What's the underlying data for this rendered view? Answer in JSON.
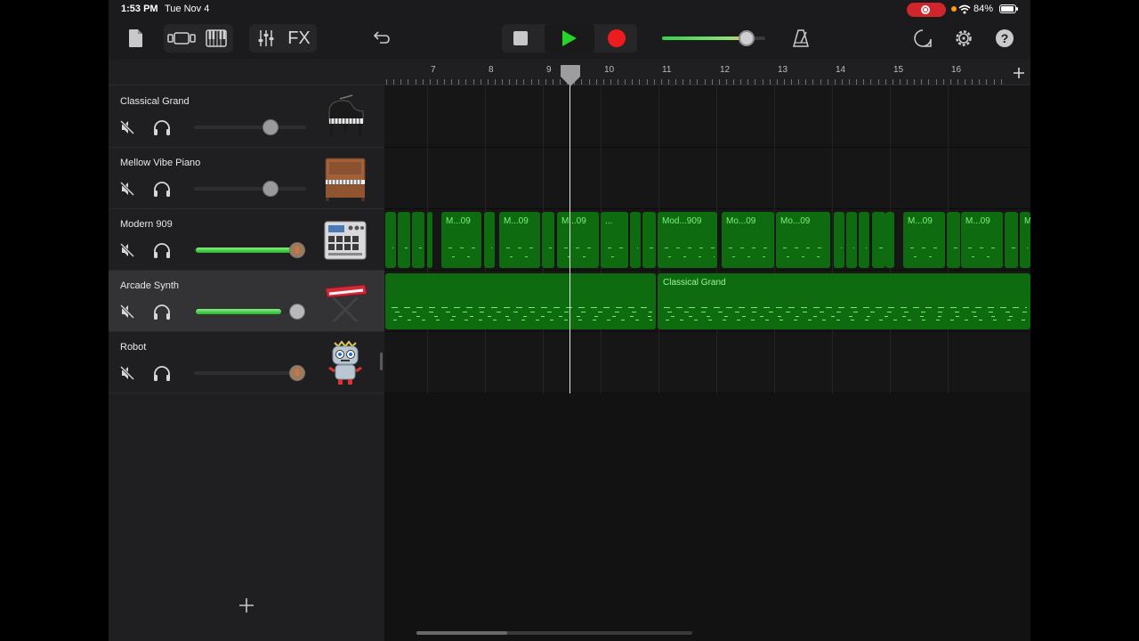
{
  "status_bar": {
    "time": "1:53 PM",
    "date": "Tue Nov 4",
    "battery": "84%"
  },
  "toolbar": {
    "fx_label": "FX",
    "help_label": "?"
  },
  "master_volume": 0.82,
  "tracks": [
    {
      "name": "Classical Grand",
      "icon": "grand-piano-icon",
      "volume": 0.68,
      "meter": 0
    },
    {
      "name": "Mellow Vibe Piano",
      "icon": "upright-piano-icon",
      "volume": 0.68,
      "meter": 0
    },
    {
      "name": "Modern 909",
      "icon": "drum-machine-icon",
      "volume": 0.92,
      "meter": 0.92
    },
    {
      "name": "Arcade Synth",
      "icon": "synth-keyboard-icon",
      "volume": 0.92,
      "meter": 0.76
    },
    {
      "name": "Robot",
      "icon": "robot-icon",
      "volume": 0.92,
      "meter": 0
    }
  ],
  "ruler": {
    "bars": [
      "7",
      "8",
      "9",
      "10",
      "11",
      "12",
      "13",
      "14",
      "15",
      "16"
    ]
  },
  "regions": {
    "modern909": [
      "",
      "",
      "",
      "M...09",
      "M...09",
      "M...09",
      "...",
      "",
      "Mod...909",
      "Mo...09",
      "Mo...09",
      "",
      "",
      "",
      "",
      "M...09",
      "M...09",
      "",
      "M"
    ],
    "arcade_synth": [
      "",
      "Classical Grand"
    ]
  },
  "colors": {
    "region_green": "#0e6b10",
    "note_green": "#5fe35c",
    "record_red": "#ee1c1c",
    "play_green": "#28d32a"
  }
}
